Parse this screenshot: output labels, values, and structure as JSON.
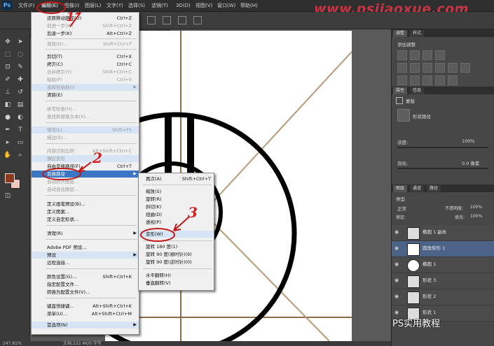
{
  "app": {
    "logo": "Ps"
  },
  "menubar": {
    "items": [
      "文件(F)",
      "编辑(E)",
      "图像(I)",
      "图层(L)",
      "文字(Y)",
      "选择(S)",
      "滤镜(T)",
      "3D(D)",
      "视图(V)",
      "窗口(W)",
      "帮助(H)"
    ],
    "active": "编辑(E)"
  },
  "watermark": "www.psjiaoxue.com",
  "wechat_label": "PS实用教程",
  "edit_menu": {
    "items": [
      {
        "label": "还原移动路径(O)",
        "shortcut": "Ctrl+Z",
        "state": "enabled"
      },
      {
        "label": "前进一步(W)",
        "shortcut": "Shift+Ctrl+Z",
        "state": "disabled"
      },
      {
        "label": "后退一步(K)",
        "shortcut": "Alt+Ctrl+Z",
        "state": "enabled"
      },
      {
        "label": "渐隐(D)...",
        "shortcut": "Shift+Ctrl+F",
        "state": "disabled"
      },
      {
        "label": "剪切(T)",
        "shortcut": "Ctrl+X",
        "state": "enabled"
      },
      {
        "label": "拷贝(C)",
        "shortcut": "Ctrl+C",
        "state": "enabled"
      },
      {
        "label": "合并拷贝(Y)",
        "shortcut": "Shift+Ctrl+C",
        "state": "disabled"
      },
      {
        "label": "粘贴(P)",
        "shortcut": "Ctrl+V",
        "state": "disabled"
      },
      {
        "label": "选择性粘贴(I)",
        "shortcut": "",
        "state": "disabled-sub"
      },
      {
        "label": "清除(E)",
        "shortcut": "",
        "state": "enabled"
      },
      {
        "label": "拼写检查(H)...",
        "shortcut": "",
        "state": "disabled"
      },
      {
        "label": "查找和替换文本(X)...",
        "shortcut": "",
        "state": "disabled"
      },
      {
        "label": "填充(L)...",
        "shortcut": "Shift+F5",
        "state": "disabled"
      },
      {
        "label": "描边(S)...",
        "shortcut": "",
        "state": "disabled"
      },
      {
        "label": "内容识别比例",
        "shortcut": "Alt+Shift+Ctrl+C",
        "state": "disabled"
      },
      {
        "label": "操控变形",
        "shortcut": "",
        "state": "disabled"
      },
      {
        "label": "自由变换路径(F)",
        "shortcut": "Ctrl+T",
        "state": "enabled"
      },
      {
        "label": "变换路径",
        "shortcut": "",
        "state": "active-sub"
      },
      {
        "label": "自动对齐图层...",
        "shortcut": "",
        "state": "disabled"
      },
      {
        "label": "自动混合图层...",
        "shortcut": "",
        "state": "disabled"
      },
      {
        "label": "定义画笔预设(B)...",
        "shortcut": "",
        "state": "enabled"
      },
      {
        "label": "定义图案...",
        "shortcut": "",
        "state": "enabled"
      },
      {
        "label": "定义自定形状...",
        "shortcut": "",
        "state": "enabled"
      },
      {
        "label": "清理(R)",
        "shortcut": "",
        "state": "enabled-sub"
      },
      {
        "label": "Adobe PDF 预设...",
        "shortcut": "",
        "state": "enabled"
      },
      {
        "label": "预设",
        "shortcut": "",
        "state": "hl-sub"
      },
      {
        "label": "远程连接...",
        "shortcut": "",
        "state": "enabled"
      },
      {
        "label": "颜色设置(G)...",
        "shortcut": "Shift+Ctrl+K",
        "state": "enabled"
      },
      {
        "label": "指定配置文件...",
        "shortcut": "",
        "state": "enabled"
      },
      {
        "label": "转换为配置文件(V)...",
        "shortcut": "",
        "state": "enabled"
      },
      {
        "label": "键盘快捷键...",
        "shortcut": "Alt+Shift+Ctrl+K",
        "state": "enabled"
      },
      {
        "label": "菜单(U)...",
        "shortcut": "Alt+Shift+Ctrl+M",
        "state": "enabled"
      },
      {
        "label": "首选项(N)",
        "shortcut": "",
        "state": "hl-sub"
      }
    ]
  },
  "transform_submenu": {
    "items": [
      {
        "label": "再次(A)",
        "shortcut": "Shift+Ctrl+T",
        "state": "enabled"
      },
      {
        "label": "缩放(S)",
        "shortcut": "",
        "state": "enabled"
      },
      {
        "label": "旋转(R)",
        "shortcut": "",
        "state": "enabled"
      },
      {
        "label": "斜切(K)",
        "shortcut": "",
        "state": "enabled"
      },
      {
        "label": "扭曲(D)",
        "shortcut": "",
        "state": "enabled"
      },
      {
        "label": "透视(P)",
        "shortcut": "",
        "state": "enabled"
      },
      {
        "label": "变形(W)",
        "shortcut": "",
        "state": "hl"
      },
      {
        "label": "旋转 180 度(1)",
        "shortcut": "",
        "state": "enabled"
      },
      {
        "label": "旋转 90 度(顺时针)(9)",
        "shortcut": "",
        "state": "enabled"
      },
      {
        "label": "旋转 90 度(逆时针)(0)",
        "shortcut": "",
        "state": "enabled"
      },
      {
        "label": "水平翻转(H)",
        "shortcut": "",
        "state": "enabled"
      },
      {
        "label": "垂直翻转(V)",
        "shortcut": "",
        "state": "enabled"
      }
    ]
  },
  "annotations": {
    "n1": "1",
    "n2": "2",
    "n3": "3"
  },
  "panels": {
    "adjust_tabs": [
      "调整",
      "样式"
    ],
    "adjust_title": "添加调整",
    "props_tabs": [
      "属性",
      "信息"
    ],
    "props_title": "蒙版",
    "props_sub": "形状路径",
    "density_label": "浓度:",
    "density_value": "100%",
    "feather_label": "羽化:",
    "feather_value": "0.0 像素",
    "layers_tabs": [
      "图层",
      "通道",
      "路径"
    ],
    "kind_label": "类型",
    "blend_mode": "正常",
    "opacity_label": "不透明度:",
    "opacity_value": "100%",
    "lock_label": "锁定:",
    "fill_label": "填充:",
    "fill_value": "100%",
    "layers": [
      {
        "name": "椭圆 1 副本",
        "selected": false
      },
      {
        "name": "圆角矩形 1",
        "selected": true
      },
      {
        "name": "椭圆 1",
        "selected": false
      },
      {
        "name": "形状 3",
        "selected": false
      },
      {
        "name": "形状 2",
        "selected": false
      },
      {
        "name": "形状 1",
        "selected": false
      }
    ]
  },
  "status": {
    "zoom": "247.81%",
    "doc": "文档:222.4K/0 字节"
  },
  "colors": {
    "foreground": "#8b3a1e",
    "background": "#f0c8c0",
    "selection": "#3b76c5",
    "annotation": "#d42020"
  }
}
